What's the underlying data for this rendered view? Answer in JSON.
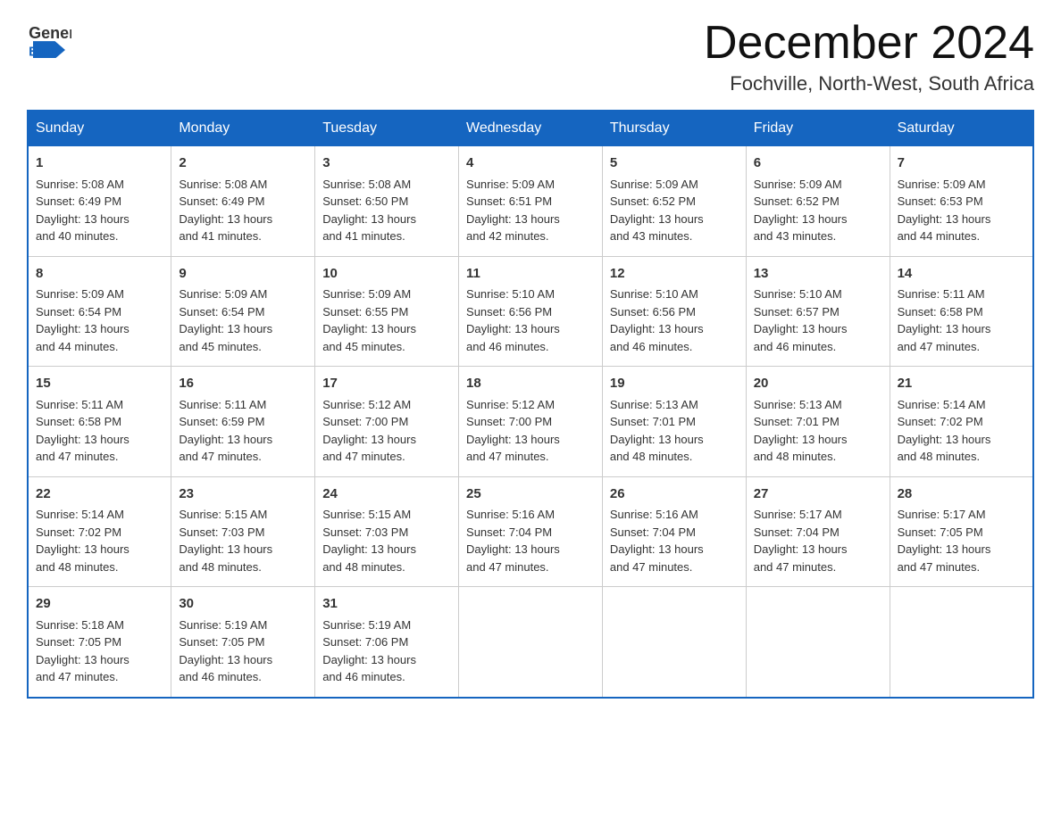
{
  "header": {
    "logo_general": "General",
    "logo_blue": "Blue",
    "month_title": "December 2024",
    "location": "Fochville, North-West, South Africa"
  },
  "weekdays": [
    "Sunday",
    "Monday",
    "Tuesday",
    "Wednesday",
    "Thursday",
    "Friday",
    "Saturday"
  ],
  "weeks": [
    [
      {
        "day": "1",
        "sunrise": "5:08 AM",
        "sunset": "6:49 PM",
        "daylight": "13 hours and 40 minutes."
      },
      {
        "day": "2",
        "sunrise": "5:08 AM",
        "sunset": "6:49 PM",
        "daylight": "13 hours and 41 minutes."
      },
      {
        "day": "3",
        "sunrise": "5:08 AM",
        "sunset": "6:50 PM",
        "daylight": "13 hours and 41 minutes."
      },
      {
        "day": "4",
        "sunrise": "5:09 AM",
        "sunset": "6:51 PM",
        "daylight": "13 hours and 42 minutes."
      },
      {
        "day": "5",
        "sunrise": "5:09 AM",
        "sunset": "6:52 PM",
        "daylight": "13 hours and 43 minutes."
      },
      {
        "day": "6",
        "sunrise": "5:09 AM",
        "sunset": "6:52 PM",
        "daylight": "13 hours and 43 minutes."
      },
      {
        "day": "7",
        "sunrise": "5:09 AM",
        "sunset": "6:53 PM",
        "daylight": "13 hours and 44 minutes."
      }
    ],
    [
      {
        "day": "8",
        "sunrise": "5:09 AM",
        "sunset": "6:54 PM",
        "daylight": "13 hours and 44 minutes."
      },
      {
        "day": "9",
        "sunrise": "5:09 AM",
        "sunset": "6:54 PM",
        "daylight": "13 hours and 45 minutes."
      },
      {
        "day": "10",
        "sunrise": "5:09 AM",
        "sunset": "6:55 PM",
        "daylight": "13 hours and 45 minutes."
      },
      {
        "day": "11",
        "sunrise": "5:10 AM",
        "sunset": "6:56 PM",
        "daylight": "13 hours and 46 minutes."
      },
      {
        "day": "12",
        "sunrise": "5:10 AM",
        "sunset": "6:56 PM",
        "daylight": "13 hours and 46 minutes."
      },
      {
        "day": "13",
        "sunrise": "5:10 AM",
        "sunset": "6:57 PM",
        "daylight": "13 hours and 46 minutes."
      },
      {
        "day": "14",
        "sunrise": "5:11 AM",
        "sunset": "6:58 PM",
        "daylight": "13 hours and 47 minutes."
      }
    ],
    [
      {
        "day": "15",
        "sunrise": "5:11 AM",
        "sunset": "6:58 PM",
        "daylight": "13 hours and 47 minutes."
      },
      {
        "day": "16",
        "sunrise": "5:11 AM",
        "sunset": "6:59 PM",
        "daylight": "13 hours and 47 minutes."
      },
      {
        "day": "17",
        "sunrise": "5:12 AM",
        "sunset": "7:00 PM",
        "daylight": "13 hours and 47 minutes."
      },
      {
        "day": "18",
        "sunrise": "5:12 AM",
        "sunset": "7:00 PM",
        "daylight": "13 hours and 47 minutes."
      },
      {
        "day": "19",
        "sunrise": "5:13 AM",
        "sunset": "7:01 PM",
        "daylight": "13 hours and 48 minutes."
      },
      {
        "day": "20",
        "sunrise": "5:13 AM",
        "sunset": "7:01 PM",
        "daylight": "13 hours and 48 minutes."
      },
      {
        "day": "21",
        "sunrise": "5:14 AM",
        "sunset": "7:02 PM",
        "daylight": "13 hours and 48 minutes."
      }
    ],
    [
      {
        "day": "22",
        "sunrise": "5:14 AM",
        "sunset": "7:02 PM",
        "daylight": "13 hours and 48 minutes."
      },
      {
        "day": "23",
        "sunrise": "5:15 AM",
        "sunset": "7:03 PM",
        "daylight": "13 hours and 48 minutes."
      },
      {
        "day": "24",
        "sunrise": "5:15 AM",
        "sunset": "7:03 PM",
        "daylight": "13 hours and 48 minutes."
      },
      {
        "day": "25",
        "sunrise": "5:16 AM",
        "sunset": "7:04 PM",
        "daylight": "13 hours and 47 minutes."
      },
      {
        "day": "26",
        "sunrise": "5:16 AM",
        "sunset": "7:04 PM",
        "daylight": "13 hours and 47 minutes."
      },
      {
        "day": "27",
        "sunrise": "5:17 AM",
        "sunset": "7:04 PM",
        "daylight": "13 hours and 47 minutes."
      },
      {
        "day": "28",
        "sunrise": "5:17 AM",
        "sunset": "7:05 PM",
        "daylight": "13 hours and 47 minutes."
      }
    ],
    [
      {
        "day": "29",
        "sunrise": "5:18 AM",
        "sunset": "7:05 PM",
        "daylight": "13 hours and 47 minutes."
      },
      {
        "day": "30",
        "sunrise": "5:19 AM",
        "sunset": "7:05 PM",
        "daylight": "13 hours and 46 minutes."
      },
      {
        "day": "31",
        "sunrise": "5:19 AM",
        "sunset": "7:06 PM",
        "daylight": "13 hours and 46 minutes."
      },
      null,
      null,
      null,
      null
    ]
  ],
  "labels": {
    "sunrise": "Sunrise:",
    "sunset": "Sunset:",
    "daylight": "Daylight:"
  }
}
